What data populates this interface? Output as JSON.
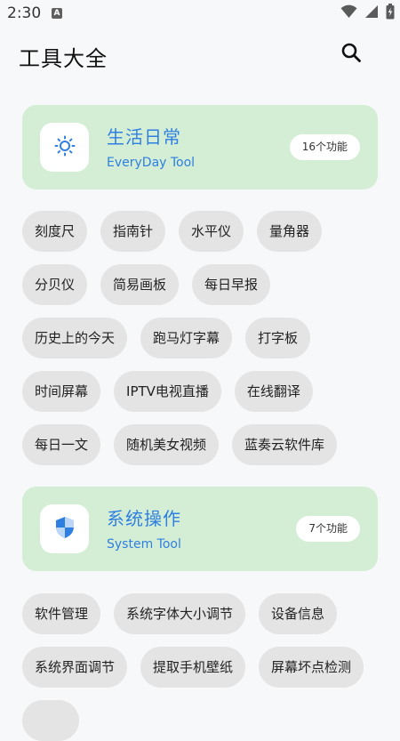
{
  "status_bar": {
    "time": "2:30",
    "notification_badge": "A",
    "icons": [
      "wifi-icon",
      "signal-icon",
      "battery-icon"
    ]
  },
  "header": {
    "title": "工具大全",
    "search_icon": "search-icon"
  },
  "categories": [
    {
      "title": "生活日常",
      "subtitle": "EveryDay Tool",
      "count": "16个功能",
      "icon": "sun-icon",
      "tools": [
        "刻度尺",
        "指南针",
        "水平仪",
        "量角器",
        "分贝仪",
        "简易画板",
        "每日早报",
        "历史上的今天",
        "跑马灯字幕",
        "打字板",
        "时间屏幕",
        "IPTV电视直播",
        "在线翻译",
        "每日一文",
        "随机美女视频",
        "蓝奏云软件库"
      ]
    },
    {
      "title": "系统操作",
      "subtitle": "System Tool",
      "count": "7个功能",
      "icon": "shield-icon",
      "tools": [
        "软件管理",
        "系统字体大小调节",
        "设备信息",
        "系统界面调节",
        "提取手机壁纸",
        "屏幕坏点检测"
      ]
    }
  ],
  "colors": {
    "card_bg": "#d4eed6",
    "accent": "#2f7fe0",
    "chip_bg": "#e4e4e4",
    "page_bg": "#f7f8fa"
  }
}
